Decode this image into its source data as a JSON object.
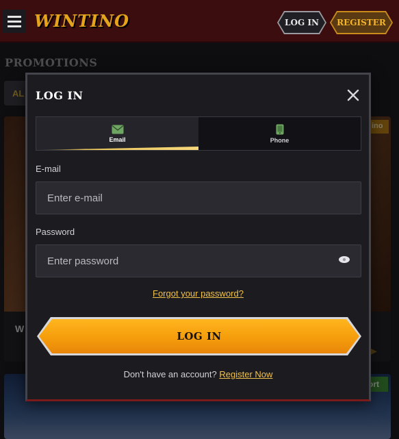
{
  "header": {
    "logo": "WINTINO",
    "login_label": "LOG IN",
    "register_label": "REGISTER"
  },
  "page": {
    "title": "PROMOTIONS",
    "filter_chip": "AL",
    "promo_card_title_fragment": "W",
    "promo_badge_1": "ino",
    "promo_badge_2": "ort"
  },
  "modal": {
    "title": "LOG IN",
    "tabs": [
      {
        "label": "Email",
        "icon": "envelope-icon",
        "active": true
      },
      {
        "label": "Phone",
        "icon": "phone-icon",
        "active": false
      }
    ],
    "email": {
      "label": "E-mail",
      "placeholder": "Enter e-mail"
    },
    "password": {
      "label": "Password",
      "placeholder": "Enter password"
    },
    "forgot_label": "Forgot your password?",
    "submit_label": "LOG IN",
    "signup_prompt": "Don't have an account?",
    "signup_link": "Register Now"
  },
  "colors": {
    "accent": "#f0c14b",
    "button": "#f59d0c",
    "header_bg": "#3b0d0f",
    "icon_green": "#6fa562"
  }
}
